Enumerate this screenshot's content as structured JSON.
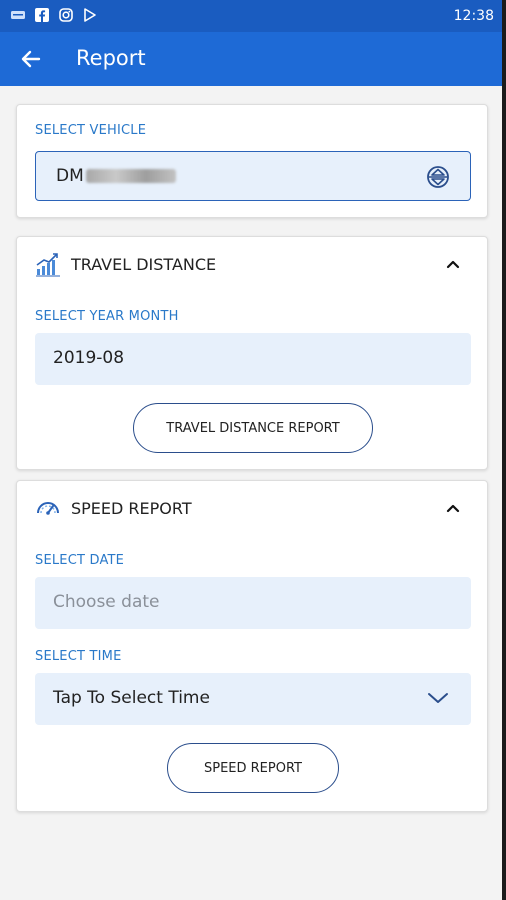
{
  "status_bar": {
    "time": "12:38",
    "icons": [
      "message-icon",
      "facebook-icon",
      "instagram-icon",
      "play-store-icon"
    ]
  },
  "app_bar": {
    "title": "Report",
    "back_icon": "arrow-left-icon"
  },
  "vehicle_card": {
    "label": "SELECT VEHICLE",
    "value_prefix": "DM",
    "spinner_icon": "up-down-spinner-icon"
  },
  "travel_card": {
    "title": "TRAVEL DISTANCE",
    "icon": "bar-chart-icon",
    "collapse_icon": "chevron-up-icon",
    "month_label": "SELECT YEAR MONTH",
    "month_value": "2019-08",
    "button_label": "TRAVEL DISTANCE REPORT"
  },
  "speed_card": {
    "title": "SPEED REPORT",
    "icon": "speedometer-icon",
    "collapse_icon": "chevron-up-icon",
    "date_label": "SELECT DATE",
    "date_placeholder": "Choose date",
    "time_label": "SELECT TIME",
    "time_value": "Tap To Select Time",
    "time_dropdown_icon": "chevron-down-icon",
    "button_label": "SPEED REPORT"
  },
  "colors": {
    "status_bar": "#1a5cc0",
    "app_bar": "#1e6ad6",
    "label_blue": "#2a79c9",
    "field_bg": "#e7f0fb",
    "border_blue": "#2b63b8"
  }
}
